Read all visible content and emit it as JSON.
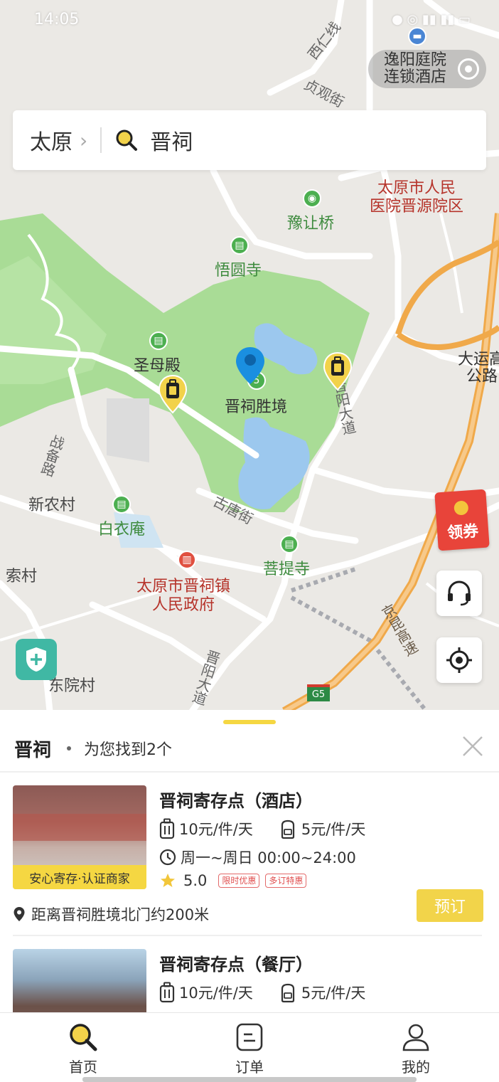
{
  "status_bar": {
    "time": "14:05"
  },
  "search": {
    "city": "太原",
    "query": "晋祠"
  },
  "map": {
    "hotel_chip": {
      "line1": "逸阳庭院",
      "line2": "连锁酒店"
    },
    "pois": {
      "xiren": "西仁线",
      "kanguan": "贞观街",
      "hospital_l1": "太原市人民",
      "hospital_l2": "医院晋源院区",
      "yurangqiao": "豫让桥",
      "wuyuansi": "悟圆寺",
      "shengmudian": "圣母殿",
      "jincishengjing": "晋祠胜境",
      "jinyang": "晋阳大道",
      "dayun_l1": "大运高",
      "dayun_l2": "公路",
      "zhanbeilu": "战备路",
      "xinnongcun": "新农村",
      "baiyian": "白衣庵",
      "gutangjie": "古唐街",
      "putisi": "菩提寺",
      "suocun": "索村",
      "gov_l1": "太原市晋祠镇",
      "gov_l2": "人民政府",
      "dongyuancun": "东院村",
      "jinyang2": "晋阳大道",
      "jingkun": "京昆高速",
      "g5": "G5"
    },
    "coupon_label": "领券"
  },
  "results": {
    "keyword": "晋祠",
    "found_text": "为您找到2个",
    "items": [
      {
        "title": "晋祠寄存点（酒店）",
        "price_large": "10元/件/天",
        "price_small": "5元/件/天",
        "hours": "周一~周日 00:00~24:00",
        "rating": "5.0",
        "tag1": "限时优惠",
        "tag2": "多订特惠",
        "badge": "安心寄存·认证商家",
        "distance": "距离晋祠胜境北门约200米",
        "book_label": "预订"
      },
      {
        "title": "晋祠寄存点（餐厅）",
        "price_large": "10元/件/天",
        "price_small": "5元/件/天"
      }
    ]
  },
  "tabs": [
    {
      "label": "首页",
      "icon": "search-icon"
    },
    {
      "label": "订单",
      "icon": "order-icon"
    },
    {
      "label": "我的",
      "icon": "user-icon"
    }
  ],
  "colors": {
    "accent": "#f5d742",
    "park": "#a8dc94",
    "water": "#9cc8ee",
    "highway": "#f0a94a"
  }
}
